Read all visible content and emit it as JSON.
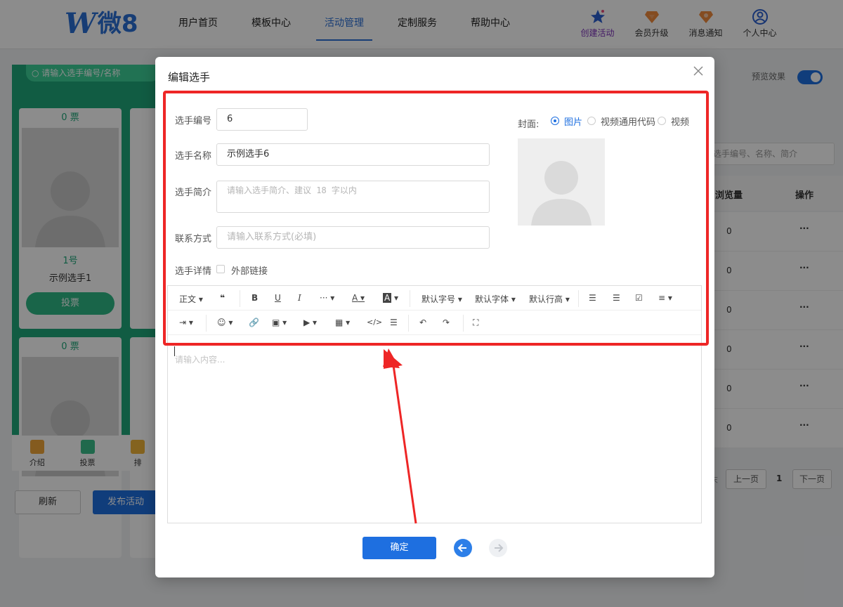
{
  "header": {
    "logo_text": "微8",
    "nav": [
      "用户首页",
      "模板中心",
      "活动管理",
      "定制服务",
      "帮助中心"
    ],
    "active_nav": "活动管理",
    "icons": [
      {
        "label": "创建活动",
        "icon": "star-icon"
      },
      {
        "label": "会员升级",
        "icon": "diamond-icon"
      },
      {
        "label": "消息通知",
        "icon": "notification-icon"
      },
      {
        "label": "个人中心",
        "icon": "user-icon"
      }
    ]
  },
  "background": {
    "phone_search_placeholder": "请输入选手编号/名称",
    "cards": [
      {
        "votes": "0 票",
        "number": "1号",
        "name": "示例选手1",
        "vote_label": "投票"
      },
      {
        "votes": "0 票"
      }
    ],
    "phone_tabs": [
      "介绍",
      "投票",
      "排"
    ],
    "refresh_label": "刷新",
    "publish_label": "发布活动",
    "preview_label": "预览效果",
    "table_search_placeholder": "选手编号、名称、简介",
    "table_headers": [
      "浏览量",
      "操作"
    ],
    "table_rows": [
      {
        "views": "0",
        "action": "···"
      },
      {
        "views": "0",
        "action": "···"
      },
      {
        "views": "0",
        "action": "···"
      },
      {
        "views": "0",
        "action": "···"
      },
      {
        "views": "0",
        "action": "···"
      },
      {
        "views": "0",
        "action": "···"
      }
    ],
    "pager": {
      "prev_cut": "末",
      "prev": "上一页",
      "current": "1",
      "next": "下一页"
    }
  },
  "modal": {
    "title": "编辑选手",
    "fields": {
      "number_label": "选手编号",
      "number_value": "6",
      "name_label": "选手名称",
      "name_value": "示例选手6",
      "intro_label": "选手简介",
      "intro_placeholder": "请输入选手简介、建议 18 字以内",
      "contact_label": "联系方式",
      "contact_placeholder": "请输入联系方式(必填)",
      "detail_label": "选手详情",
      "external_link_label": "外部链接"
    },
    "cover": {
      "label": "封面:",
      "options": [
        "图片",
        "视频通用代码",
        "视频"
      ],
      "selected": "图片"
    },
    "toolbar": {
      "row1": [
        "正文",
        "❝",
        "B",
        "U",
        "I",
        "···",
        "A",
        "A",
        "默认字号",
        "默认字体",
        "默认行高",
        "☰",
        "☰",
        "☑",
        "≡"
      ],
      "row2": [
        "⇥",
        "☺",
        "🔗",
        "▣",
        "▶",
        "▦",
        "</>",
        "☰",
        "↶",
        "↷",
        "⛶"
      ]
    },
    "editor_placeholder": "请输入内容...",
    "confirm_label": "确定"
  }
}
